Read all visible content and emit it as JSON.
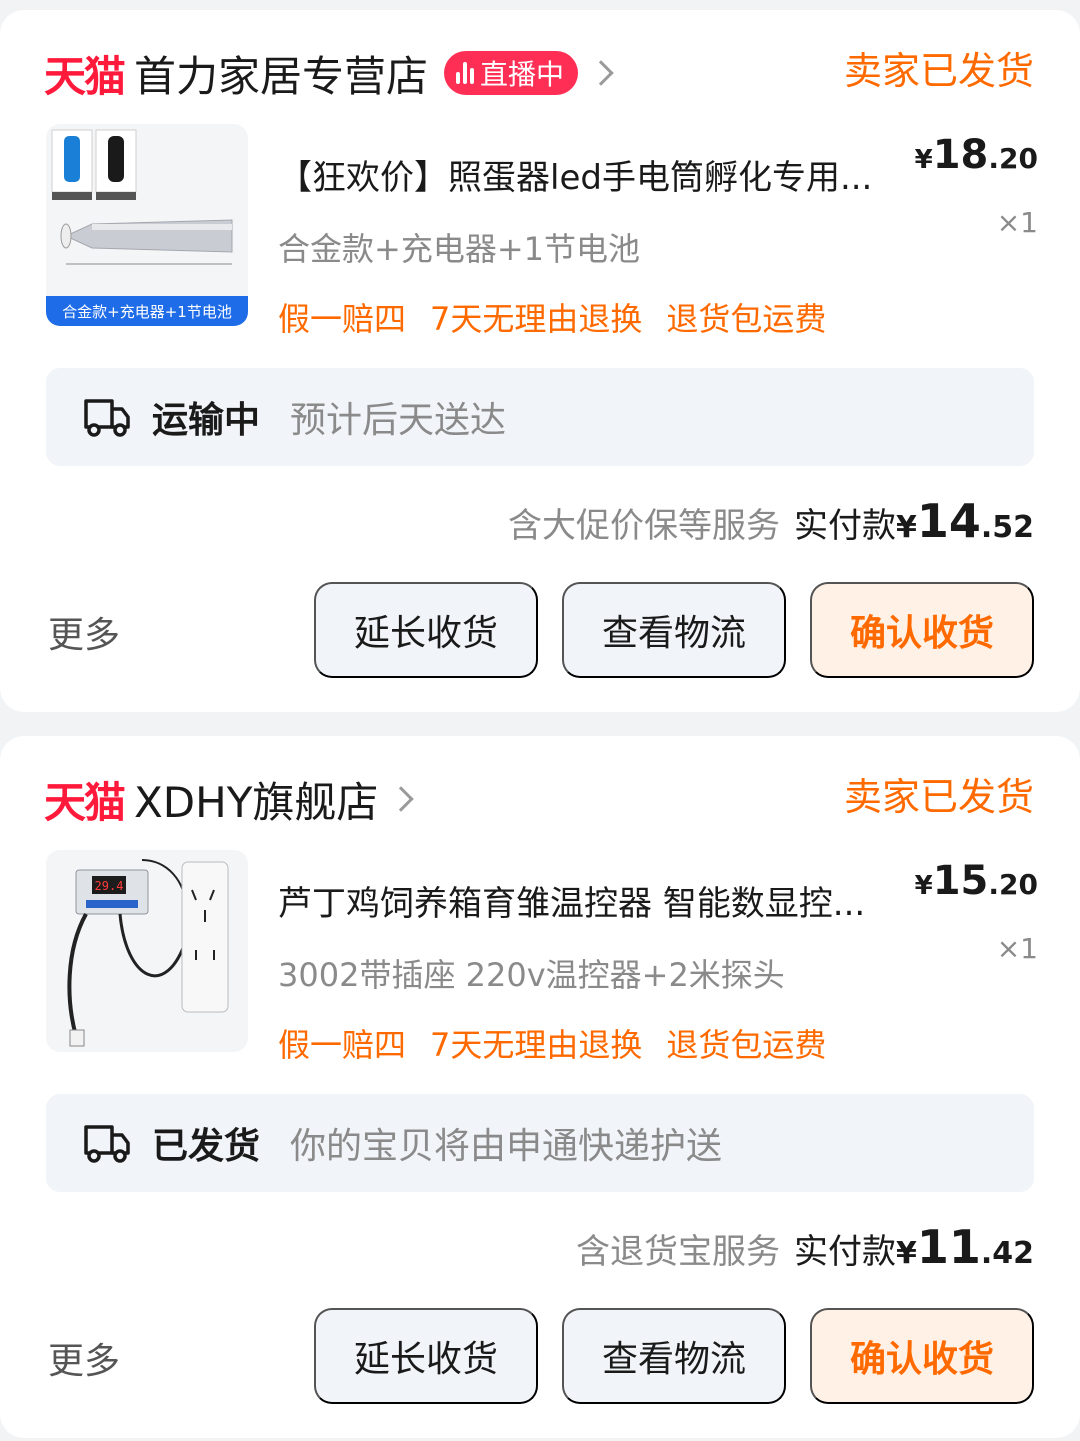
{
  "colors": {
    "tmall_red": "#ff1a3c",
    "accent_orange": "#ff6a00",
    "button_bg": "#f1f4f8",
    "confirm_bg": "#fff1e6",
    "page_bg": "#f2f3f5"
  },
  "orders": [
    {
      "platform_logo": "天猫",
      "shop_name": "首力家居专营店",
      "live_badge": "直播中",
      "status": "卖家已发货",
      "thumb_caption": "合金款+充电器+1节电池",
      "title": "【狂欢价】照蛋器led手电筒孵化专用...",
      "sku": "合金款+充电器+1节电池",
      "price_yen": "¥",
      "price_int": "18",
      "price_dec": ".20",
      "qty": "×1",
      "tags": [
        "假一赔四",
        "7天无理由退换",
        "退货包运费"
      ],
      "logistics_icon": "truck-icon",
      "logistics_status": "运输中",
      "logistics_desc": "预计后天送达",
      "pay_service": "含大促价保等服务",
      "pay_label": "实付款",
      "pay_yen": "¥",
      "pay_int": "14",
      "pay_dec": ".52",
      "more": "更多",
      "btn_extend": "延长收货",
      "btn_logistics": "查看物流",
      "btn_confirm": "确认收货"
    },
    {
      "platform_logo": "天猫",
      "shop_name": "XDHY旗舰店",
      "status": "卖家已发货",
      "thumb_display": "29.4",
      "title": "芦丁鸡饲养箱育雏温控器 智能数显控...",
      "sku": "3002带插座 220v温控器+2米探头",
      "price_yen": "¥",
      "price_int": "15",
      "price_dec": ".20",
      "qty": "×1",
      "tags": [
        "假一赔四",
        "7天无理由退换",
        "退货包运费"
      ],
      "logistics_icon": "truck-icon",
      "logistics_status": "已发货",
      "logistics_desc": "你的宝贝将由申通快递护送",
      "pay_service": "含退货宝服务",
      "pay_label": "实付款",
      "pay_yen": "¥",
      "pay_int": "11",
      "pay_dec": ".42",
      "more": "更多",
      "btn_extend": "延长收货",
      "btn_logistics": "查看物流",
      "btn_confirm": "确认收货"
    }
  ]
}
